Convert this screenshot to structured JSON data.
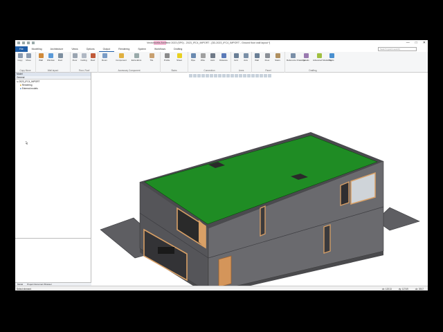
{
  "titlebar": {
    "title": "Vectorworks Architect 2023 (SP0) - 2023_IFC4_IMPORT - [3D-2023_IFC4_IMPORT - Ground floor wall layout *]",
    "window_controls": [
      "—",
      "□",
      "✕"
    ]
  },
  "menubar": {
    "tabs": [
      "File",
      "Modelling",
      "Architecture",
      "Views",
      "Options",
      "Output",
      "Rendering",
      "System",
      "Workflows",
      "Drafting"
    ],
    "search_placeholder": "Search (quick search)"
  },
  "ribbon": {
    "groups": [
      {
        "label": "Copy Move",
        "buttons": [
          "Copy",
          "Move"
        ]
      },
      {
        "label": "Wall layout",
        "buttons": [
          "Wall",
          "Window",
          "Door"
        ]
      },
      {
        "label": "Floor, Roof",
        "buttons": [
          "Floor",
          "Ceiling",
          "Roof"
        ]
      },
      {
        "label": "Accessory Component",
        "buttons": [
          "Room",
          "Component",
          "Extra Elms",
          "Tile"
        ]
      },
      {
        "label": "Stairs",
        "buttons": [
          "Profile",
          "Sheet"
        ]
      },
      {
        "label": "Connection",
        "buttons": [
          "Pipe",
          "Wire",
          "Joint",
          "Distance"
        ]
      },
      {
        "label": "Lines",
        "buttons": [
          "Grid",
          "Axis"
        ]
      },
      {
        "label": "Panel",
        "buttons": [
          "Wall",
          "Floor",
          "Stairs"
        ]
      },
      {
        "label": "Drafting",
        "buttons": [
          "Reference Drawings",
          "Details",
          "Advanced Modelling",
          "Tools"
        ]
      }
    ]
  },
  "leftpanel": {
    "header": "Model",
    "subheader": "General",
    "tree": [
      {
        "label": "2023_IFC4_IMPORT",
        "indent": false
      },
      {
        "label": "Rendering",
        "indent": true
      },
      {
        "label": "External models",
        "indent": true
      }
    ],
    "bottom_tabs": [
      "Model",
      "Project Document Browser"
    ]
  },
  "statusbar": {
    "message": "Select element",
    "coords": [
      "dx: 12013",
      "dy: 12749",
      "dz: 3917"
    ]
  },
  "colors": {
    "roof": "#1f8c24",
    "wall_dark": "#5c5c60",
    "wall_light": "#6e6e72",
    "frame": "#d9a066",
    "accent": "#1e5ea8"
  }
}
